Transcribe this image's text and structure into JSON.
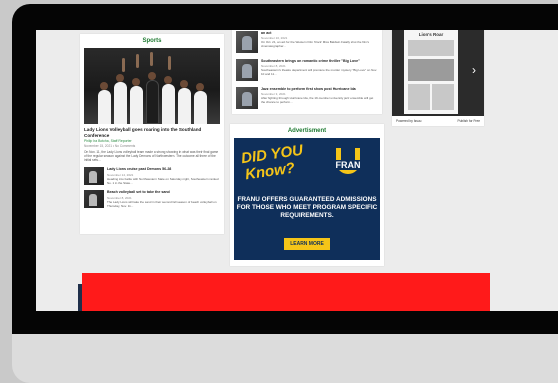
{
  "sports": {
    "section_title": "Sports",
    "hero_title": "Lady Lions Volleyball goes roaring into the Southland Conference",
    "hero_byline": "Philip Ira Botcha, Staff Reporter",
    "hero_meta": "November 15, 2021 • No Comments",
    "hero_excerpt": "On Nov. 11, the Lady Lions volleyball team made a strong showing in what was their final game of the regular season against the Lady Demons of Northwestern. The outcome all three of the initial sets...",
    "items": [
      {
        "title": "Lady Lions cruise past Demons 56-28",
        "meta": "November 14, 2021",
        "excerpt": "Heading into battle with Northwestern State on Saturday night, Southeastern ranked No. 1 in the State..."
      },
      {
        "title": "Beach volleyball set to take the sand",
        "meta": "November 8, 2021",
        "excerpt": "The Lady Lions will take the sand in their second fall season of beach volleyball on Thursday, Nov. 11..."
      }
    ]
  },
  "news": {
    "items": [
      {
        "title": "an act",
        "meta": "November 10, 2021",
        "excerpt": "On Oct. 21, an act for the Western Film 'Rock' Miss Baldwin Fatally shot the film's cinematographer..."
      },
      {
        "title": "Southeastern brings on romantic crime thriller \"Big Love\"",
        "meta": "November 8, 2021",
        "excerpt": "Southeastern's theatre department will premiere the murder mystery \"Big Love\" on Nov. 10 and 11..."
      },
      {
        "title": "Jazz ensemble to perform first show post Hurricane Ida",
        "meta": "November 3, 2021",
        "excerpt": "After fighting through Hurricane Ida, the 19-member university jazz ensemble will get the chance to perform..."
      }
    ]
  },
  "advertisement": {
    "section_title": "Advertisment",
    "headline_1": "DID YOU",
    "headline_2": "Know?",
    "logo_text": "FRAN",
    "copy": "FRANU OFFERS GUARANTEED ADMISSIONS FOR THOSE WHO MEET PROGRAM SPECIFIC REQUIREMENTS.",
    "button_label": "LEARN MORE",
    "colors": {
      "navy": "#0f2f5a",
      "gold": "#f5c518"
    }
  },
  "widget": {
    "masthead": "Lion's Roar",
    "footer_left": "Powered by Issuu",
    "footer_right": "Publish for Free",
    "arrow_icon": "chevron-right-icon"
  },
  "colors": {
    "accent_green": "#1f7a32",
    "banner_red": "#ff1a1a"
  }
}
